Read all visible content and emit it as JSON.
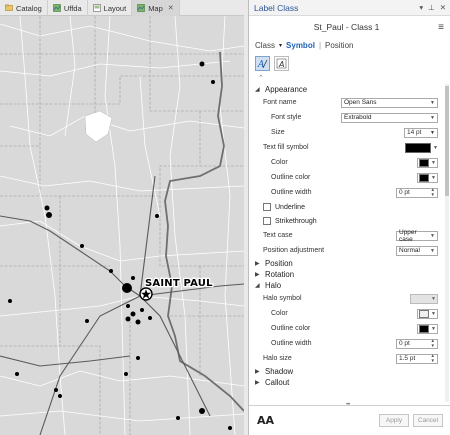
{
  "tabs": [
    {
      "label": "Catalog",
      "icon": "catalog-icon"
    },
    {
      "label": "Uffda",
      "icon": "map-icon"
    },
    {
      "label": "Layout",
      "icon": "layout-icon"
    },
    {
      "label": "Map",
      "icon": "map-icon",
      "active": true
    }
  ],
  "map": {
    "label": "SAINT PAUL"
  },
  "pane": {
    "title": "Label Class",
    "class_name": "St_Paul - Class 1",
    "class_dropdown_label": "Class",
    "subtabs": [
      "Symbol",
      "Position"
    ],
    "sections": {
      "appearance": "Appearance",
      "position": "Position",
      "rotation": "Rotation",
      "halo": "Halo",
      "shadow": "Shadow",
      "callout": "Callout"
    },
    "fields": {
      "font_name_label": "Font name",
      "font_name_value": "Open Sans",
      "font_style_label": "Font style",
      "font_style_value": "Extrabold",
      "size_label": "Size",
      "size_value": "14 pt",
      "text_fill_label": "Text fill symbol",
      "color_label": "Color",
      "outline_color_label": "Outline color",
      "outline_width_label": "Outline width",
      "outline_width_value": "0 pt",
      "underline_label": "Underline",
      "strikethrough_label": "Strikethrough",
      "text_case_label": "Text case",
      "text_case_value": "Upper case",
      "position_adjustment_label": "Position adjustment",
      "position_adjustment_value": "Normal",
      "halo_symbol_label": "Halo symbol",
      "halo_color_label": "Color",
      "halo_outline_color_label": "Outline color",
      "halo_outline_width_label": "Outline width",
      "halo_outline_width_value": "0 pt",
      "halo_size_label": "Halo size",
      "halo_size_value": "1.5 pt"
    },
    "footer": {
      "preview_text": "AA",
      "apply_label": "Apply",
      "cancel_label": "Cancel"
    }
  },
  "colors": {
    "accent": "#1f62b5",
    "map_background": "#d9d9d9",
    "highway": "#6f6f6f"
  }
}
